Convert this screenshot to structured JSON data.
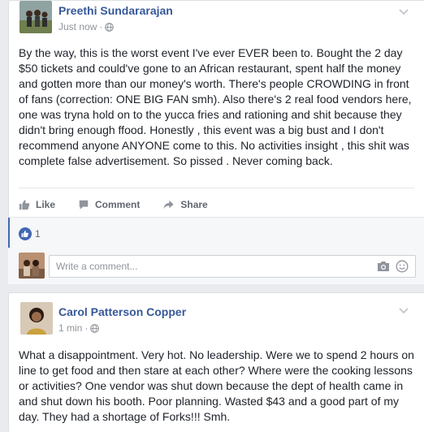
{
  "posts": [
    {
      "author": "Preethi Sundararajan",
      "time": "Just now",
      "separator": "·",
      "privacy_icon": "globe-icon",
      "text": "By the way, this is the worst event I've ever EVER been to. Bought the 2 day $50 tickets and could've gone to an African restaurant, spent half the money and gotten more than our money's worth. There's people CROWDING in front of fans (correction: ONE BIG FAN smh). Also there's 2 real food vendors here, one was tryna hold on to the yucca fries and rationing and shit because they didn't bring enough ffood. Honestly , this event was a big bust and I don't recommend anyone ANYONE come to this. No activities insight , this shit was complete false advertisement. So pissed . Never coming back.",
      "actions": {
        "like": "Like",
        "comment": "Comment",
        "share": "Share"
      },
      "reaction_count": "1",
      "comment_placeholder": "Write a comment..."
    },
    {
      "author": "Carol Patterson Copper",
      "time": "1 min",
      "separator": "·",
      "privacy_icon": "globe-icon",
      "text": "What a disappointment. Very hot. No leadership. Were we to spend 2 hours on line to get food and then stare at each other? Where were the cooking lessons or activities? One vendor was shut down because the dept of health came in and shut down his booth. Poor planning. Wasted $43 and a good part of my day. They had a shortage of Forks!!! Smh."
    }
  ],
  "colors": {
    "link": "#365899",
    "like_blue": "#4267b2",
    "muted": "#90949c",
    "page_bg": "#e9ebee"
  }
}
